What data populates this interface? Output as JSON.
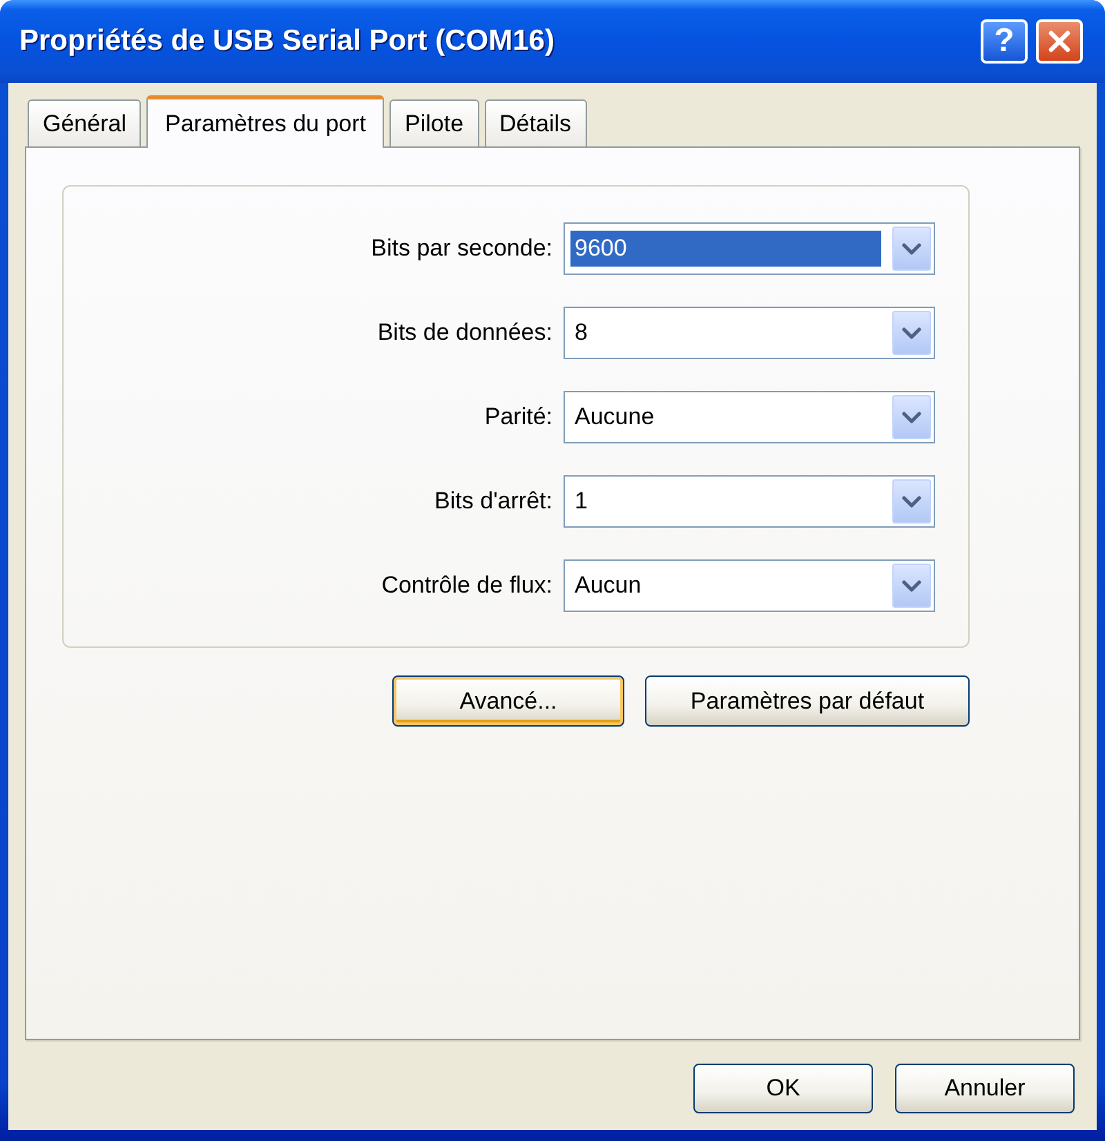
{
  "window": {
    "title": "Propriétés de USB Serial Port (COM16)",
    "help_button": "?"
  },
  "tabs": [
    {
      "label": "Général",
      "selected": false
    },
    {
      "label": "Paramètres du port",
      "selected": true
    },
    {
      "label": "Pilote",
      "selected": false
    },
    {
      "label": "Détails",
      "selected": false
    }
  ],
  "port_settings": [
    {
      "label": "Bits par seconde:",
      "value": "9600",
      "highlighted": true
    },
    {
      "label": "Bits de données:",
      "value": "8",
      "highlighted": false
    },
    {
      "label": "Parité:",
      "value": "Aucune",
      "highlighted": false
    },
    {
      "label": "Bits d'arrêt:",
      "value": "1",
      "highlighted": false
    },
    {
      "label": "Contrôle de flux:",
      "value": "Aucun",
      "highlighted": false
    }
  ],
  "panel_buttons": [
    {
      "label": "Avancé...",
      "focused": true
    },
    {
      "label": "Paramètres par défaut",
      "focused": false
    }
  ],
  "dialog_buttons": [
    {
      "label": "OK"
    },
    {
      "label": "Annuler"
    }
  ]
}
